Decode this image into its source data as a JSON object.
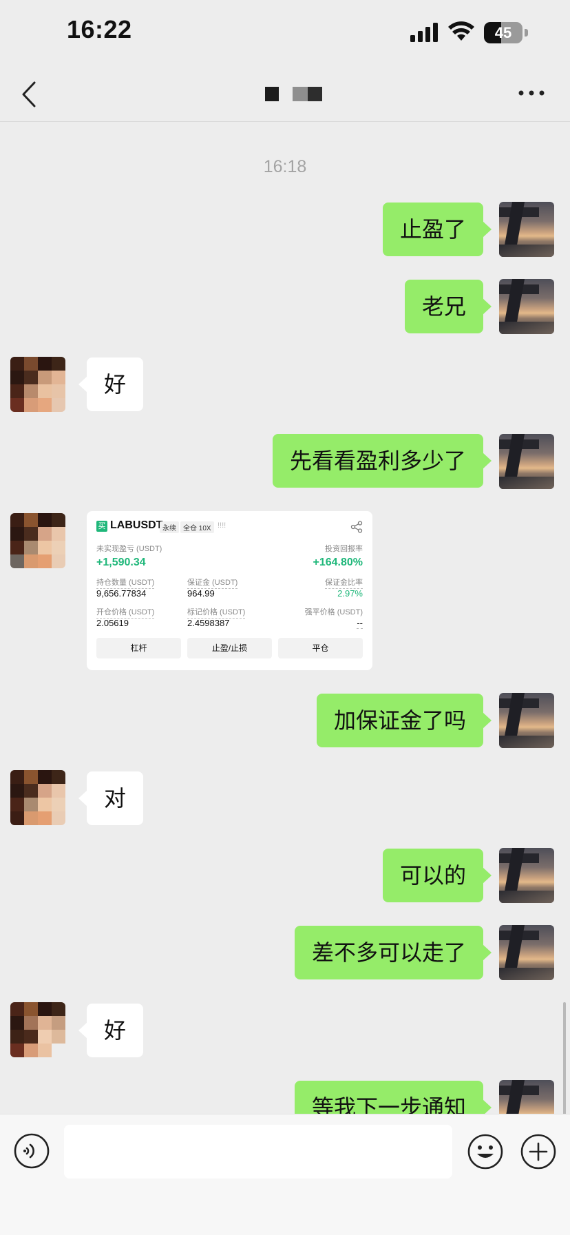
{
  "status_bar": {
    "time": "16:22",
    "battery": "45",
    "battery_level": 0.45
  },
  "nav": {
    "back_icon": "chevron-left-icon",
    "more_icon": "ellipsis-icon"
  },
  "timestamp": "16:18",
  "messages": [
    {
      "from": "me",
      "text": "止盈了"
    },
    {
      "from": "me",
      "text": "老兄"
    },
    {
      "from": "them",
      "text": "好"
    },
    {
      "from": "me",
      "text": "先看看盈利多少了"
    },
    {
      "from": "them",
      "type": "image"
    },
    {
      "from": "me",
      "text": "加保证金了吗"
    },
    {
      "from": "them",
      "text": "对"
    },
    {
      "from": "me",
      "text": "可以的"
    },
    {
      "from": "me",
      "text": "差不多可以走了"
    },
    {
      "from": "them",
      "text": "好"
    },
    {
      "from": "me",
      "text": "等我下一步通知"
    }
  ],
  "trade_card": {
    "icon_text": "买",
    "symbol": "LABUSDT",
    "tag_perpetual": "永续",
    "tag_margin": "全仓 10X",
    "bars": "!!!!",
    "unrealized_pnl_label": "未实现盈亏 (USDT)",
    "unrealized_pnl_value": "+1,590.34",
    "roi_label": "投资回报率",
    "roi_value": "+164.80%",
    "position_size_label": "持仓数量 (USDT)",
    "position_size_value": "9,656.77834",
    "margin_label": "保证金 (USDT)",
    "margin_value": "964.99",
    "margin_ratio_label": "保证金比率",
    "margin_ratio_value": "2.97%",
    "entry_price_label": "开仓价格 (USDT)",
    "entry_price_value": "2.05619",
    "mark_price_label": "标记价格 (USDT)",
    "mark_price_value": "2.4598387",
    "liq_price_label": "强平价格 (USDT)",
    "liq_price_value": "--",
    "buttons": [
      "杠杆",
      "止盈/止损",
      "平仓"
    ]
  },
  "input_bar": {
    "voice_icon": "voice-icon",
    "emoji_icon": "emoji-icon",
    "plus_icon": "plus-icon"
  },
  "colors": {
    "my_bubble": "#95ec69",
    "their_bubble": "#ffffff",
    "background": "#ededed",
    "profit_green": "#1fb77a"
  }
}
